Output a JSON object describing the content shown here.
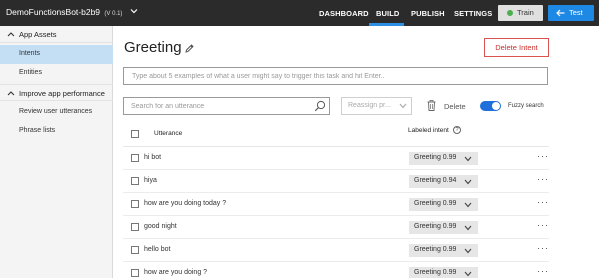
{
  "topbar": {
    "app_name": "DemoFunctionsBot-b2b9",
    "app_version": "(V 0.1)",
    "nav": [
      "DASHBOARD",
      "BUILD",
      "PUBLISH",
      "SETTINGS"
    ],
    "train_label": "Train",
    "test_label": "Test"
  },
  "sidebar": {
    "app_assets": "App Assets",
    "intents": "Intents",
    "entities": "Entities",
    "improve": "Improve app performance",
    "review": "Review user utterances",
    "phrase_lists": "Phrase lists"
  },
  "main": {
    "title": "Greeting",
    "delete_intent": "Delete Intent",
    "utterance_placeholder": "Type about 5 examples of what a user might say to trigger this task and hit Enter..",
    "search_placeholder": "Search for an utterance",
    "reassign_label": "Reassign pr...",
    "delete_label": "Delete",
    "fuzzy_label": "Fuzzy search",
    "col_utterance": "Utterance",
    "col_intent": "Labeled intent",
    "help": "?",
    "more": "···"
  },
  "rows": [
    {
      "text": "hi bot",
      "intent": "Greeting 0.99"
    },
    {
      "text": "hiya",
      "intent": "Greeting 0.94"
    },
    {
      "text": "how are you doing today ?",
      "intent": "Greeting 0.99"
    },
    {
      "text": "good night",
      "intent": "Greeting 0.99"
    },
    {
      "text": "hello bot",
      "intent": "Greeting 0.99"
    },
    {
      "text": "how are you doing ?",
      "intent": "Greeting 0.99"
    }
  ],
  "colors": {
    "topbar": "#2b2b2b",
    "accent": "#2d8fe3",
    "test_button": "#1e88e5",
    "train_status": "#4caf50",
    "delete_intent": "#d9534f",
    "sidebar_active": "#c4def3"
  }
}
